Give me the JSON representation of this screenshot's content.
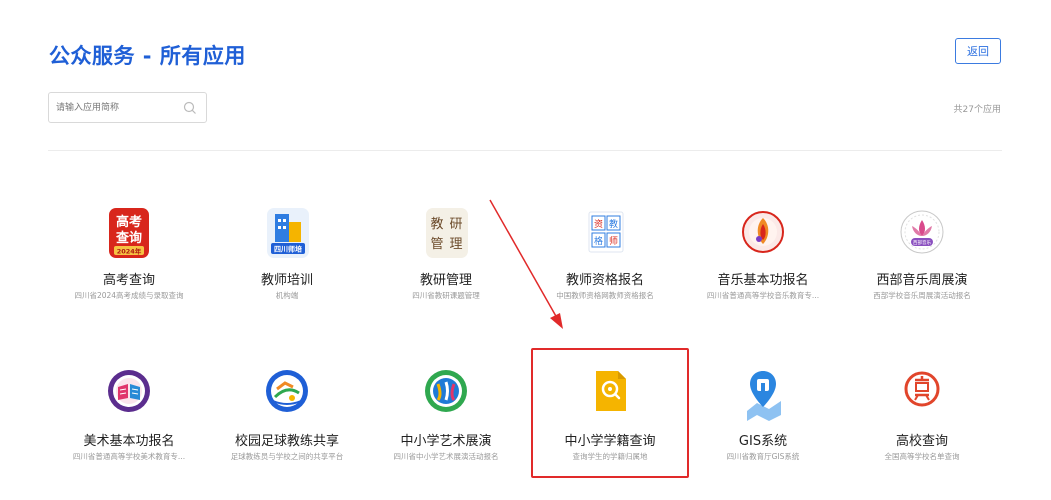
{
  "header": {
    "title": "公众服务 - 所有应用",
    "back_label": "返回"
  },
  "search": {
    "placeholder": "请输入应用简称",
    "value": ""
  },
  "app_count": "共27个应用",
  "icon_text": {
    "gaokao_line1": "高考",
    "gaokao_line2": "查询",
    "gaokao_badge": "2024年",
    "teacher_banner": "四川师培",
    "research_1": "教",
    "research_2": "研",
    "research_3": "管",
    "research_4": "理",
    "cert_1": "资",
    "cert_2": "教",
    "cert_3": "格",
    "cert_4": "师",
    "western_badge": "西部音乐"
  },
  "apps": [
    {
      "name": "高考查询",
      "desc": "四川省2024高考成绩与录取查询",
      "icon": "gaokao-icon"
    },
    {
      "name": "教师培训",
      "desc": "机构端",
      "icon": "teacher-training-icon"
    },
    {
      "name": "教研管理",
      "desc": "四川省教研课题管理",
      "icon": "teaching-research-icon"
    },
    {
      "name": "教师资格报名",
      "desc": "中国教师资格网教师资格报名",
      "icon": "teacher-cert-icon"
    },
    {
      "name": "音乐基本功报名",
      "desc": "四川省普通高等学校音乐教育专...",
      "icon": "music-skills-icon"
    },
    {
      "name": "西部音乐周展演",
      "desc": "西部学校音乐周展演活动报名",
      "icon": "western-music-icon"
    },
    {
      "name": "美术基本功报名",
      "desc": "四川省普通高等学校美术教育专...",
      "icon": "art-skills-icon"
    },
    {
      "name": "校园足球教练共享",
      "desc": "足球教练员与学校之间的共享平台",
      "icon": "football-coach-icon"
    },
    {
      "name": "中小学艺术展演",
      "desc": "四川省中小学艺术展演活动报名",
      "icon": "art-show-icon"
    },
    {
      "name": "中小学学籍查询",
      "desc": "查询学生的学籍归属地",
      "icon": "student-record-icon"
    },
    {
      "name": "GIS系统",
      "desc": "四川省教育厅GIS系统",
      "icon": "gis-icon"
    },
    {
      "name": "高校查询",
      "desc": "全国高等学校名单查询",
      "icon": "university-icon"
    }
  ],
  "colors": {
    "title": "#1f5fd6",
    "highlight": "#e12a2a",
    "gaokao_red": "#d8261c",
    "teacher_blue": "#2f7de1",
    "record_yellow": "#f5b400",
    "gis_blue": "#2b86e0",
    "university_red": "#e1452b"
  }
}
